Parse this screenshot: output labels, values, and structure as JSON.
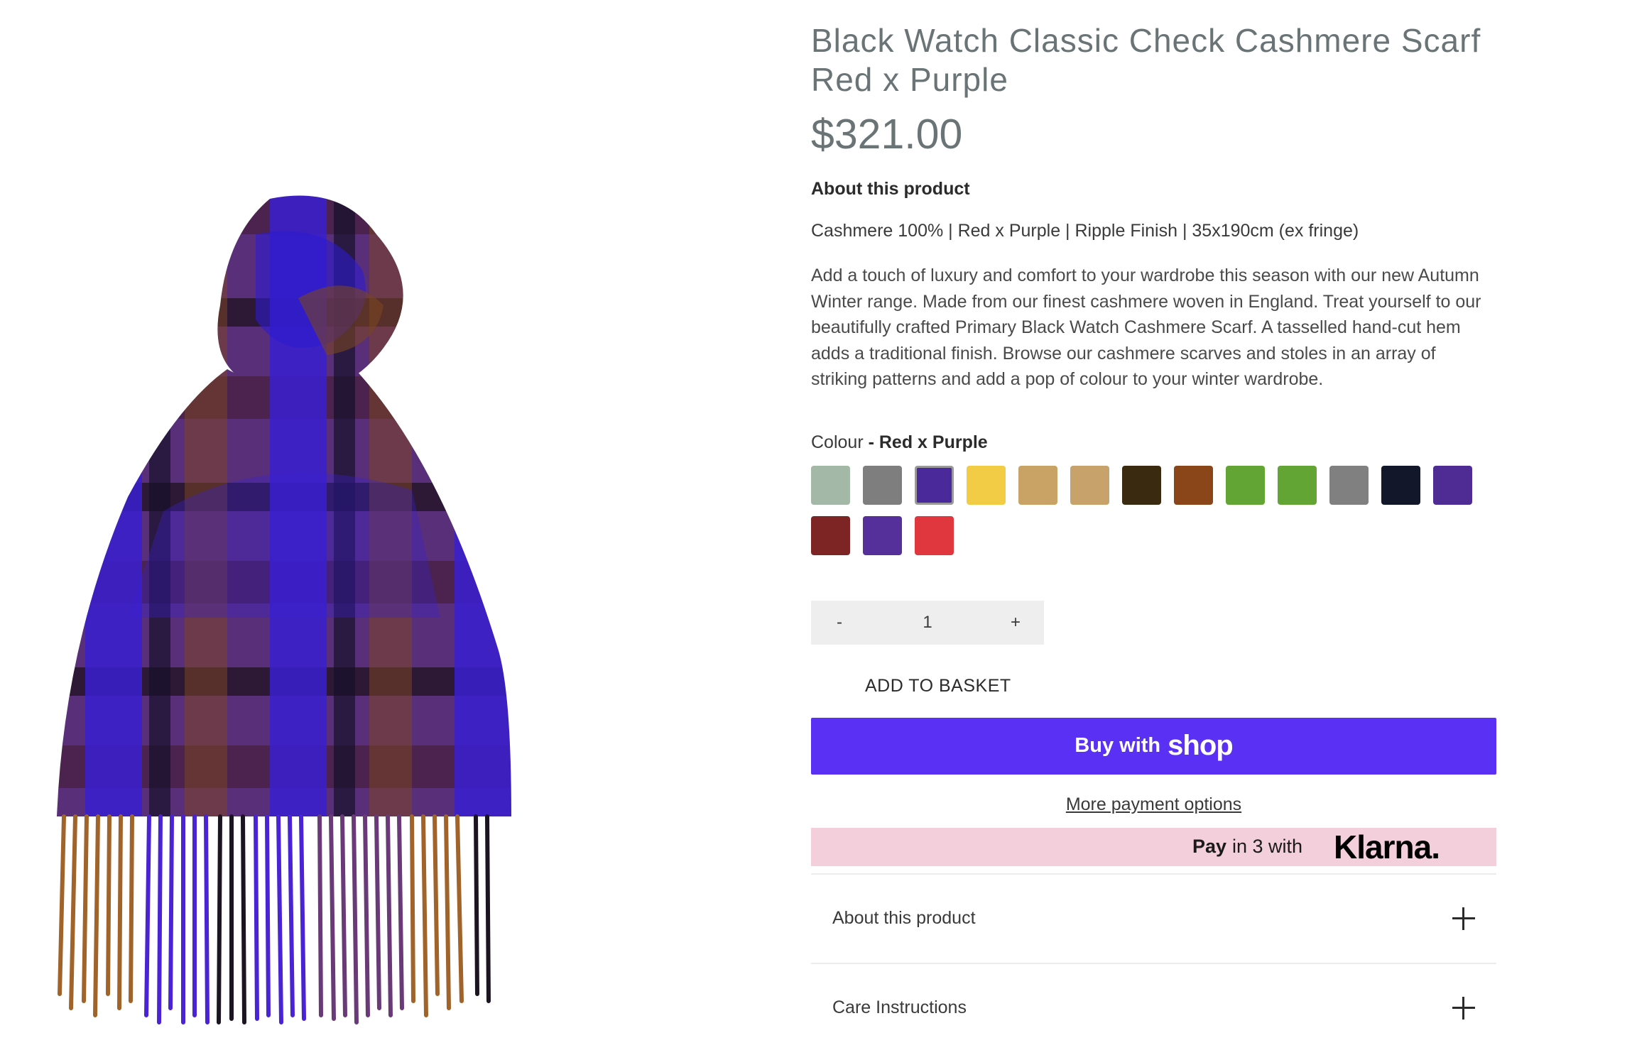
{
  "product": {
    "title": "Black Watch Classic Check Cashmere Scarf Red x Purple",
    "price": "$321.00",
    "about_heading": "About this product",
    "spec": "Cashmere 100% | Red x Purple | Ripple Finish | 35x190cm (ex fringe)",
    "description": "Add a touch of luxury and comfort to your wardrobe this season with our new Autumn Winter range. Made from our finest cashmere woven in England. Treat yourself to our beautifully crafted Primary Black Watch Cashmere Scarf. A tasselled hand-cut hem adds a traditional finish. Browse our cashmere scarves and stoles in an array of striking patterns and add a pop of colour to your winter wardrobe."
  },
  "colour": {
    "label": "Colour",
    "separator": " - ",
    "selected": "Red x Purple",
    "swatches": [
      {
        "color": "#a3b8a6",
        "active": false
      },
      {
        "color": "#7e7e7e",
        "active": false
      },
      {
        "color": "#4a2a9a",
        "active": true
      },
      {
        "color": "#f2cc45",
        "active": false
      },
      {
        "color": "#c9a265",
        "active": false
      },
      {
        "color": "#c7a26a",
        "active": false
      },
      {
        "color": "#3a2b10",
        "active": false
      },
      {
        "color": "#8a4519",
        "active": false
      },
      {
        "color": "#62a535",
        "active": false
      },
      {
        "color": "#63a534",
        "active": false
      },
      {
        "color": "#808080",
        "active": false
      },
      {
        "color": "#12182a",
        "active": false
      },
      {
        "color": "#4f2b94",
        "active": false
      },
      {
        "color": "#7d2525",
        "active": false
      },
      {
        "color": "#56309a",
        "active": false
      },
      {
        "color": "#e0363d",
        "active": false
      }
    ]
  },
  "quantity": {
    "minus": "-",
    "value": "1",
    "plus": "+"
  },
  "actions": {
    "add_to_basket": "ADD TO BASKET",
    "buy_with": "Buy with",
    "shop_logo": "shop",
    "more_payment": "More payment options"
  },
  "klarna": {
    "pay": "Pay",
    "in3": "in 3 with",
    "logo": "Klarna."
  },
  "accordion": [
    {
      "label": "About this product"
    },
    {
      "label": "Care Instructions"
    }
  ],
  "colors": {
    "title_gray": "#6a7476",
    "shop_purple": "#5a31f4",
    "klarna_pink": "#f3cfdb"
  }
}
